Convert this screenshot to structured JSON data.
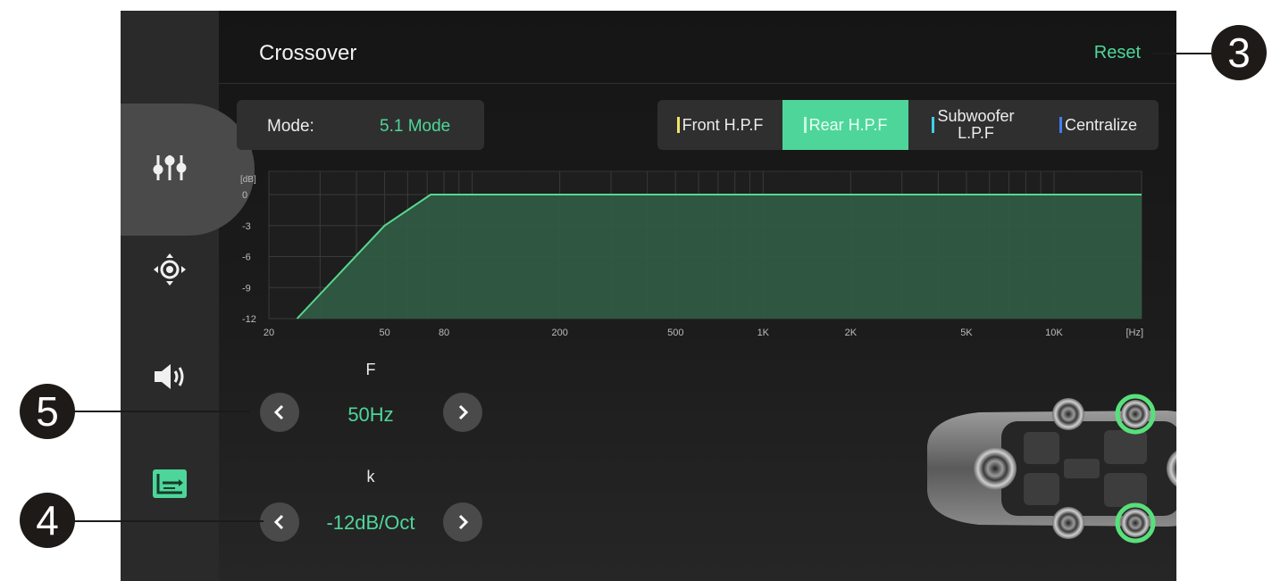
{
  "header": {
    "title": "Crossover",
    "reset_label": "Reset"
  },
  "mode": {
    "label": "Mode:",
    "value": "5.1 Mode"
  },
  "tabs": [
    {
      "label": "Front H.P.F",
      "bar_color": "#f2e36b",
      "active": false
    },
    {
      "label": "Rear H.P.F",
      "bar_color": "#c9f5df",
      "active": true
    },
    {
      "label_line1": "Subwoofer",
      "label_line2": "L.P.F",
      "bar_color": "#3fd0e6",
      "active": false
    },
    {
      "label": "Centralize",
      "bar_color": "#3f7ff0",
      "active": false
    }
  ],
  "sidebar": {
    "items": [
      {
        "icon": "equalizer-sliders-icon",
        "active": true
      },
      {
        "icon": "sound-position-icon",
        "active": false
      },
      {
        "icon": "speaker-volume-icon",
        "active": false
      },
      {
        "icon": "crossover-icon",
        "active": false
      }
    ]
  },
  "chart_data": {
    "type": "area",
    "y_unit": "[dB]",
    "x_unit": "[Hz]",
    "y_ticks": [
      "0",
      "-3",
      "-6",
      "-9",
      "-12"
    ],
    "x_ticks": [
      "20",
      "50",
      "80",
      "200",
      "500",
      "1K",
      "2K",
      "5K",
      "10K"
    ],
    "x_scale": "log",
    "ylim": [
      -12,
      0
    ],
    "grid": true,
    "series": [
      {
        "x": [
          25,
          50,
          72,
          80,
          20000
        ],
        "y": [
          -12,
          -3,
          0,
          0,
          0
        ],
        "color": "#57d88f"
      }
    ]
  },
  "controls": {
    "frequency": {
      "label": "F",
      "value": "50Hz"
    },
    "slope": {
      "label": "k",
      "value": "-12dB/Oct"
    }
  },
  "callouts": [
    "3",
    "5",
    "4"
  ],
  "colors": {
    "accent": "#4ed69a",
    "background": "#1a1a1a",
    "sidebar": "#2a2a2a"
  }
}
